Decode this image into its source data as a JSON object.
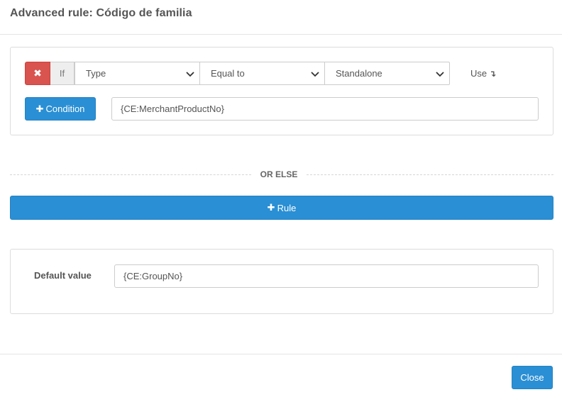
{
  "modal": {
    "title": "Advanced rule: Código de familia"
  },
  "rule": {
    "if_label": "If",
    "field_select": {
      "selected": "Type"
    },
    "operator_select": {
      "selected": "Equal to"
    },
    "value_select": {
      "selected": "Standalone"
    },
    "use_label": "Use",
    "use_icon": "arrow-down-icon",
    "add_condition_label": "Condition",
    "output_value": "{CE:MerchantProductNo}"
  },
  "or_else_label": "OR ELSE",
  "add_rule_label": "Rule",
  "default": {
    "label": "Default value",
    "value": "{CE:GroupNo}"
  },
  "footer": {
    "close_label": "Close"
  },
  "colors": {
    "primary": "#2a8fd4",
    "danger": "#d9534f",
    "border": "#cccccc",
    "addon_bg": "#eeeeee"
  }
}
